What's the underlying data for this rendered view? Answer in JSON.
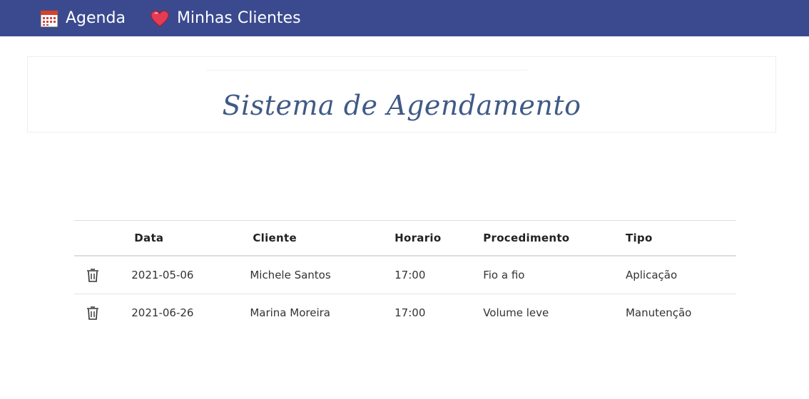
{
  "nav": {
    "items": [
      {
        "label": "Agenda",
        "icon": "calendar-icon"
      },
      {
        "label": "Minhas Clientes",
        "icon": "heart-icon"
      }
    ],
    "background": "#3b4a8f"
  },
  "hero": {
    "title": "Sistema de Agendamento",
    "title_color": "#3f5a86"
  },
  "table": {
    "headers": [
      "Data",
      "Cliente",
      "Horario",
      "Procedimento",
      "Tipo"
    ],
    "rows": [
      {
        "data": "2021-05-06",
        "cliente": "Michele Santos",
        "horario": "17:00",
        "procedimento": "Fio a fio",
        "tipo": "Aplicação"
      },
      {
        "data": "2021-06-26",
        "cliente": "Marina Moreira",
        "horario": "17:00",
        "procedimento": "Volume leve",
        "tipo": "Manutenção"
      }
    ],
    "row_action_icon": "trash-icon"
  }
}
